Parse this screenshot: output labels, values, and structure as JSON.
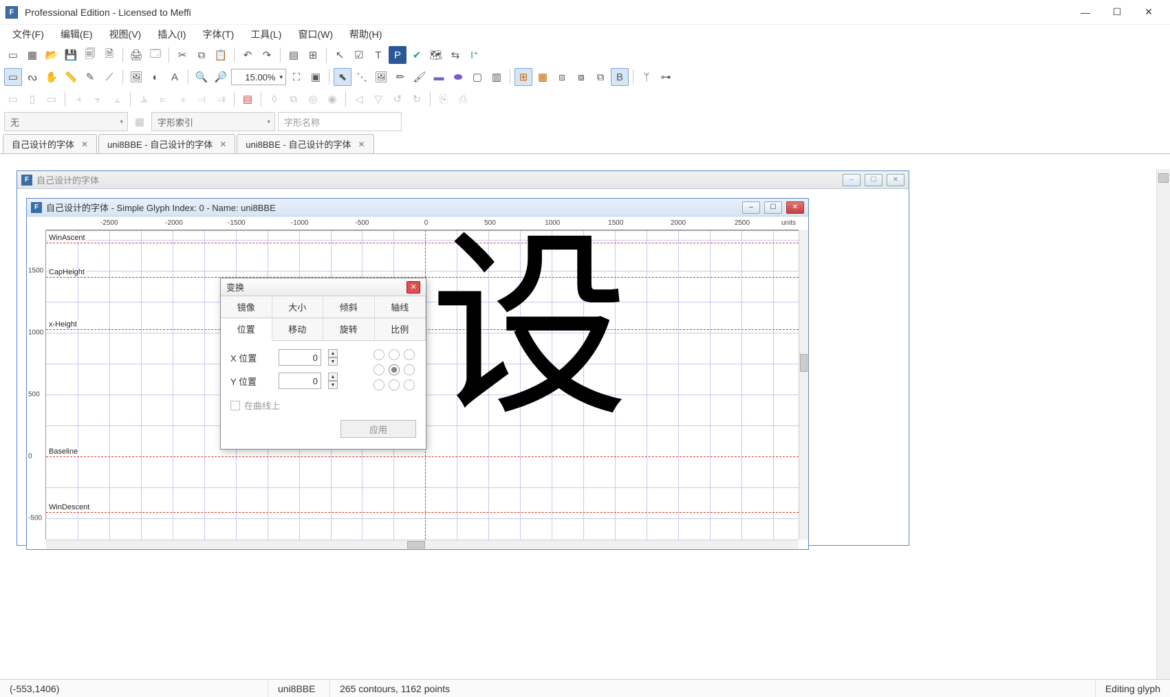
{
  "window": {
    "title": "Professional Edition - Licensed to Meffi",
    "app_icon_letter": "F"
  },
  "menu": {
    "file": "文件(F)",
    "edit": "编辑(E)",
    "view": "视图(V)",
    "insert": "插入(I)",
    "font": "字体(T)",
    "tools": "工具(L)",
    "window": "窗口(W)",
    "help": "帮助(H)"
  },
  "toolbar": {
    "zoom_value": "15.00%"
  },
  "dropdowns": {
    "category": "无",
    "sort": "字形索引",
    "name": "字形名称"
  },
  "doc_tabs": [
    {
      "label": "自己设计的字体"
    },
    {
      "label": "uni8BBE - 自己设计的字体"
    },
    {
      "label": "uni8BBE - 自己设计的字体"
    }
  ],
  "mdi_parent": {
    "title": "自己设计的字体"
  },
  "glyph_editor": {
    "title": "自己设计的字体 - Simple Glyph Index: 0 - Name: uni8BBE",
    "ruler_units": "units",
    "h_ticks": [
      "-2500",
      "-2000",
      "-1500",
      "-1000",
      "-500",
      "0",
      "500",
      "1000",
      "1500",
      "2000",
      "2500"
    ],
    "v_ticks": [
      "1500",
      "1000",
      "500",
      "0",
      "-500"
    ],
    "metrics": {
      "win_ascent": "WinAscent",
      "cap_height": "CapHeight",
      "x_height": "x-Height",
      "baseline": "Baseline",
      "win_descent": "WinDescent"
    },
    "glyph_char": "设"
  },
  "transform_dialog": {
    "title": "变换",
    "tabs_row1": {
      "mirror": "镜像",
      "size": "大小",
      "skew": "倾斜",
      "axis": "轴线"
    },
    "tabs_row2": {
      "position": "位置",
      "move": "移动",
      "rotate": "旋转",
      "scale": "比例"
    },
    "x_label": "X 位置",
    "y_label": "Y 位置",
    "x_value": "0",
    "y_value": "0",
    "on_curve": "在曲线上",
    "apply": "应用"
  },
  "status": {
    "coords": "(-553,1406)",
    "glyph": "uni8BBE",
    "info": "265 contours, 1162 points",
    "mode": "Editing glyph"
  }
}
